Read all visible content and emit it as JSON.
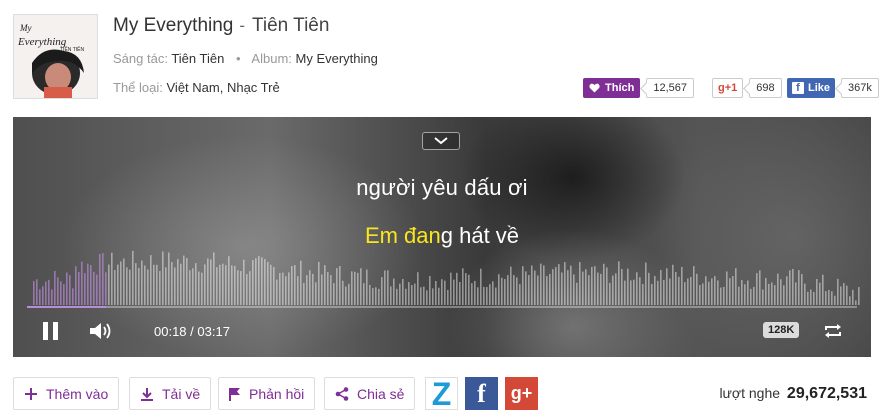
{
  "song": {
    "title": "My Everything",
    "separator": "-",
    "artist": "Tiên Tiên",
    "composer_label": "Sáng tác:",
    "composer": "Tiên Tiên",
    "album_label": "Album:",
    "album": "My Everything",
    "genre_label": "Thể loại:",
    "genre": "Việt Nam, Nhạc Trẻ",
    "cover_text": "My Everything",
    "cover_artist": "TIÊN TIÊN"
  },
  "social": {
    "like_label": "Thích",
    "like_count": "12,567",
    "gplus_label": "g+1",
    "gplus_count": "698",
    "fb_label": "Like",
    "fb_count": "367k"
  },
  "player": {
    "lyric_line1": "người yêu dấu ơi",
    "lyric_line2_highlight": "Em đan",
    "lyric_line2_rest": "g hát về",
    "current_time": "00:18",
    "total_time": "03:17",
    "time_separator": " / ",
    "quality": "128K",
    "progress": 0.095
  },
  "actions": {
    "add_label": "Thêm vào",
    "download_label": "Tải về",
    "feedback_label": "Phản hồi",
    "share_label": "Chia sẻ"
  },
  "share_icons": {
    "zing": "Z",
    "facebook": "f",
    "gplus": "g+"
  },
  "stats": {
    "listen_label": "lượt nghe",
    "listen_count": "29,672,531"
  },
  "colors": {
    "brand_purple": "#7e2e95",
    "facebook_blue": "#4267b2",
    "gplus_red": "#d34836",
    "lyric_highlight": "#f8e71c"
  }
}
